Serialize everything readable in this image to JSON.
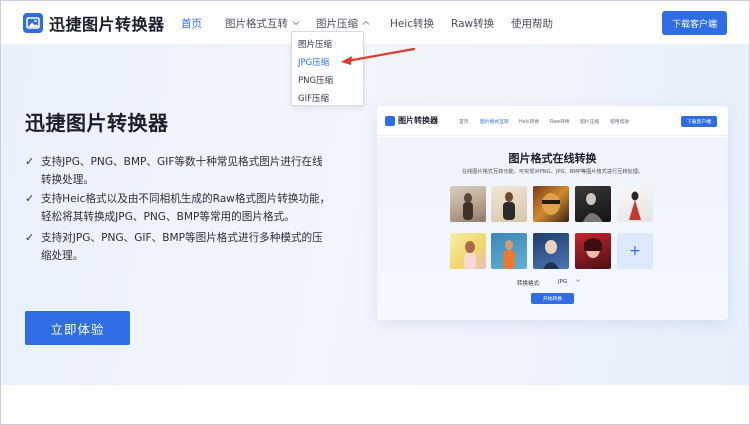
{
  "header": {
    "app_name": "迅捷图片转换器",
    "nav": [
      {
        "label": "首页",
        "active": true
      },
      {
        "label": "图片格式互转",
        "has_dropdown": true
      },
      {
        "label": "图片压缩",
        "has_dropdown": true,
        "expanded": true
      },
      {
        "label": "Heic转换"
      },
      {
        "label": "Raw转换"
      },
      {
        "label": "使用帮助"
      }
    ],
    "download_label": "下载客户端",
    "icons": {
      "logo": "image-logo-icon",
      "chevron_down": "chevron-down-icon",
      "chevron_up": "chevron-up-icon"
    }
  },
  "dropdown": {
    "items": [
      {
        "label": "图片压缩"
      },
      {
        "label": "JPG压缩",
        "highlighted": true
      },
      {
        "label": "PNG压缩"
      },
      {
        "label": "GIF压缩"
      }
    ],
    "pointer_color": "#e23a2e"
  },
  "hero": {
    "title": "迅捷图片转换器",
    "features": [
      "支持JPG、PNG、BMP、GIF等数十种常见格式图片进行在线转换处理。",
      "支持Heic格式以及由不同相机生成的Raw格式图片转换功能，轻松将其转换成JPG、PNG、BMP等常用的图片格式。",
      "支持对JPG、PNG、GIF、BMP等图片格式进行多种模式的压缩处理。"
    ],
    "check_glyph": "✓",
    "cta_label": "立即体验"
  },
  "preview": {
    "app_name": "图片转换器",
    "nav": [
      {
        "label": "首页"
      },
      {
        "label": "图片格式互转",
        "active": true
      },
      {
        "label": "Heic转换"
      },
      {
        "label": "Raw转换"
      },
      {
        "label": "图片压缩"
      },
      {
        "label": "使用帮助"
      }
    ],
    "download_label": "下载客户端",
    "title": "图片格式在线转换",
    "subtitle": "在线图片格式互转功能，可实现对PNG、JPG、BMP等图片格式进行互转处理。",
    "format_label": "转换格式:",
    "format_value": "JPG",
    "convert_label": "开始转换",
    "add_glyph": "+"
  },
  "colors": {
    "brand": "#2f6de5",
    "text_dark": "#1b1f2b",
    "annotation_red": "#e23a2e"
  }
}
